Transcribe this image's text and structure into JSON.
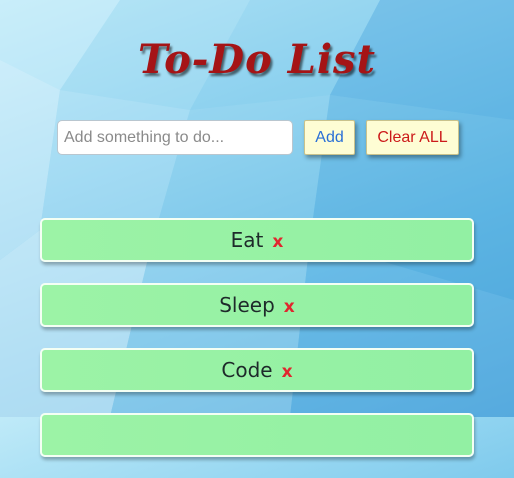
{
  "title": "To-Do List",
  "input": {
    "placeholder": "Add something to do...",
    "value": ""
  },
  "buttons": {
    "add": "Add",
    "clear_all": "Clear ALL"
  },
  "todos": [
    {
      "text": "Eat",
      "delete_label": "x"
    },
    {
      "text": "Sleep",
      "delete_label": "x"
    },
    {
      "text": "Code",
      "delete_label": "x"
    },
    {
      "text": "",
      "delete_label": ""
    }
  ],
  "colors": {
    "title": "#a51416",
    "item_bg": "#9cf3a6",
    "delete": "#e0262e",
    "button_bg": "#fefdd4",
    "add_text": "#2a6fd6",
    "clear_text": "#cc1a1a"
  }
}
